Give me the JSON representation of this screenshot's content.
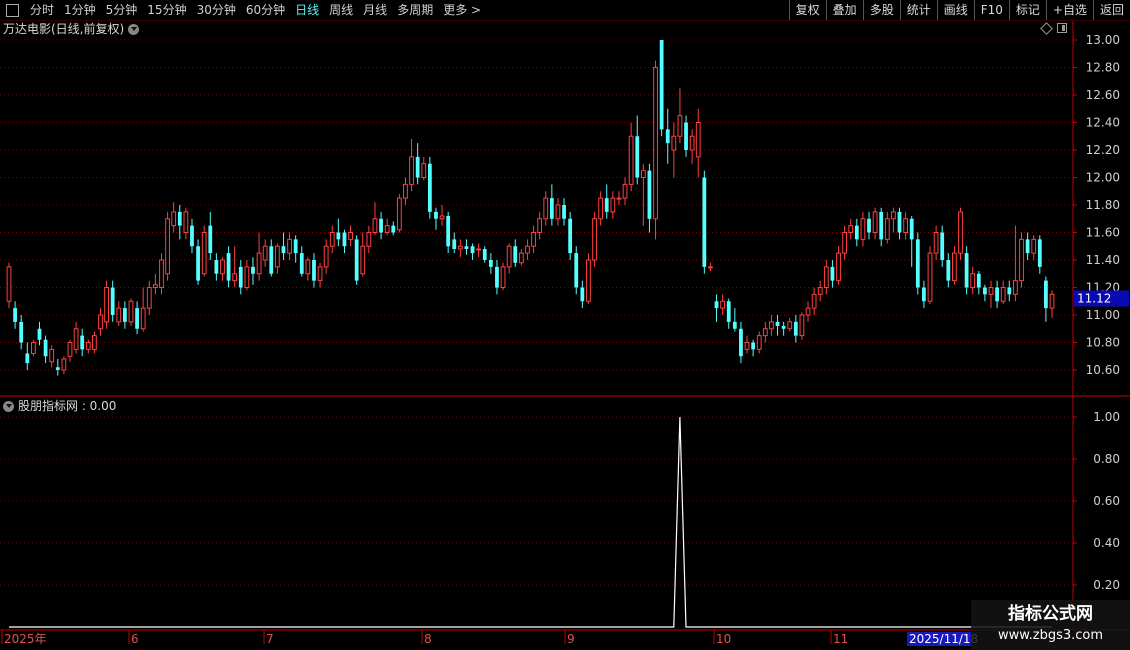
{
  "toolbar": {
    "periods": [
      "分时",
      "1分钟",
      "5分钟",
      "15分钟",
      "30分钟",
      "60分钟",
      "日线",
      "周线",
      "月线",
      "多周期",
      "更多 >"
    ],
    "active_period": "日线",
    "actions": [
      "复权",
      "叠加",
      "多股",
      "统计",
      "画线",
      "F10",
      "标记",
      "+自选",
      "返回"
    ]
  },
  "main_panel": {
    "title": "万达电影(日线,前复权)",
    "price_axis": [
      "13.00",
      "12.80",
      "12.60",
      "12.40",
      "12.20",
      "12.00",
      "11.80",
      "11.60",
      "11.40",
      "11.20",
      "11.00",
      "10.80",
      "10.60"
    ],
    "current_price_label": "11.12"
  },
  "indicator_panel": {
    "title": "股朋指标网 : 0.00",
    "axis": [
      "1.00",
      "0.80",
      "0.60",
      "0.40",
      "0.20"
    ]
  },
  "date_axis": {
    "labels": [
      "2025年",
      "6",
      "7",
      "8",
      "9",
      "10",
      "11"
    ],
    "highlight": "2025/11/18"
  },
  "watermark": {
    "line1": "指标公式网",
    "line2": "www.zbgs3.com"
  },
  "colors": {
    "up": "#ff4040",
    "down": "#54ffff",
    "grid": "#7a0000",
    "axis": "#c00000",
    "indicator_line": "#ffffff"
  },
  "chart_data": {
    "type": "candlestick",
    "ylim": [
      10.5,
      13.0
    ],
    "indicator_ylim": [
      0,
      1.0
    ],
    "candles": [
      [
        11.1,
        11.35,
        11.38,
        11.05
      ],
      [
        11.05,
        10.95,
        11.1,
        10.9
      ],
      [
        10.95,
        10.8,
        11.0,
        10.75
      ],
      [
        10.72,
        10.65,
        10.8,
        10.6
      ],
      [
        10.72,
        10.8,
        10.82,
        10.7
      ],
      [
        10.9,
        10.82,
        10.95,
        10.78
      ],
      [
        10.82,
        10.7,
        10.85,
        10.65
      ],
      [
        10.66,
        10.75,
        10.78,
        10.62
      ],
      [
        10.62,
        10.6,
        10.68,
        10.56
      ],
      [
        10.6,
        10.68,
        10.7,
        10.57
      ],
      [
        10.7,
        10.8,
        10.82,
        10.66
      ],
      [
        10.75,
        10.9,
        10.95,
        10.72
      ],
      [
        10.85,
        10.75,
        10.9,
        10.7
      ],
      [
        10.75,
        10.8,
        10.82,
        10.72
      ],
      [
        10.75,
        10.85,
        10.88,
        10.72
      ],
      [
        10.9,
        11.0,
        11.05,
        10.85
      ],
      [
        10.95,
        11.2,
        11.25,
        10.9
      ],
      [
        11.2,
        11.0,
        11.25,
        10.95
      ],
      [
        10.95,
        11.05,
        11.1,
        10.92
      ],
      [
        11.05,
        10.95,
        11.1,
        10.9
      ],
      [
        10.95,
        11.1,
        11.12,
        10.92
      ],
      [
        11.05,
        10.9,
        11.1,
        10.86
      ],
      [
        10.9,
        11.05,
        11.2,
        10.88
      ],
      [
        11.05,
        11.2,
        11.25,
        11.0
      ],
      [
        11.2,
        11.22,
        11.3,
        11.15
      ],
      [
        11.2,
        11.4,
        11.45,
        11.15
      ],
      [
        11.3,
        11.7,
        11.75,
        11.25
      ],
      [
        11.65,
        11.75,
        11.82,
        11.6
      ],
      [
        11.75,
        11.65,
        11.8,
        11.55
      ],
      [
        11.6,
        11.75,
        11.78,
        11.55
      ],
      [
        11.65,
        11.5,
        11.7,
        11.45
      ],
      [
        11.5,
        11.25,
        11.55,
        11.22
      ],
      [
        11.3,
        11.6,
        11.65,
        11.28
      ],
      [
        11.65,
        11.45,
        11.75,
        11.4
      ],
      [
        11.4,
        11.3,
        11.45,
        11.25
      ],
      [
        11.3,
        11.4,
        11.42,
        11.25
      ],
      [
        11.45,
        11.25,
        11.5,
        11.2
      ],
      [
        11.25,
        11.3,
        11.5,
        11.2
      ],
      [
        11.35,
        11.2,
        11.4,
        11.15
      ],
      [
        11.2,
        11.35,
        11.4,
        11.18
      ],
      [
        11.35,
        11.3,
        11.42,
        11.22
      ],
      [
        11.3,
        11.45,
        11.6,
        11.25
      ],
      [
        11.4,
        11.5,
        11.55,
        11.35
      ],
      [
        11.5,
        11.3,
        11.55,
        11.28
      ],
      [
        11.35,
        11.5,
        11.52,
        11.3
      ],
      [
        11.5,
        11.45,
        11.6,
        11.4
      ],
      [
        11.45,
        11.55,
        11.6,
        11.4
      ],
      [
        11.55,
        11.45,
        11.58,
        11.38
      ],
      [
        11.45,
        11.3,
        11.5,
        11.28
      ],
      [
        11.3,
        11.4,
        11.42,
        11.25
      ],
      [
        11.4,
        11.25,
        11.45,
        11.2
      ],
      [
        11.25,
        11.35,
        11.38,
        11.2
      ],
      [
        11.35,
        11.5,
        11.55,
        11.3
      ],
      [
        11.5,
        11.6,
        11.65,
        11.45
      ],
      [
        11.6,
        11.55,
        11.7,
        11.5
      ],
      [
        11.6,
        11.5,
        11.62,
        11.45
      ],
      [
        11.55,
        11.6,
        11.65,
        11.5
      ],
      [
        11.55,
        11.25,
        11.58,
        11.22
      ],
      [
        11.3,
        11.5,
        11.6,
        11.28
      ],
      [
        11.5,
        11.6,
        11.65,
        11.45
      ],
      [
        11.6,
        11.7,
        11.82,
        11.58
      ],
      [
        11.7,
        11.6,
        11.75,
        11.55
      ],
      [
        11.6,
        11.65,
        11.7,
        11.58
      ],
      [
        11.65,
        11.6,
        11.68,
        11.58
      ],
      [
        11.62,
        11.85,
        11.88,
        11.6
      ],
      [
        11.85,
        11.95,
        12.0,
        11.8
      ],
      [
        11.95,
        12.15,
        12.28,
        11.9
      ],
      [
        12.15,
        12.0,
        12.25,
        11.95
      ],
      [
        12.0,
        12.1,
        12.15,
        11.98
      ],
      [
        12.1,
        11.75,
        12.15,
        11.7
      ],
      [
        11.75,
        11.7,
        11.78,
        11.62
      ],
      [
        11.7,
        11.72,
        11.8,
        11.65
      ],
      [
        11.72,
        11.5,
        11.75,
        11.45
      ],
      [
        11.55,
        11.48,
        11.6,
        11.45
      ],
      [
        11.48,
        11.5,
        11.55,
        11.42
      ],
      [
        11.5,
        11.48,
        11.55,
        11.44
      ],
      [
        11.5,
        11.45,
        11.52,
        11.4
      ],
      [
        11.48,
        11.48,
        11.52,
        11.42
      ],
      [
        11.48,
        11.4,
        11.5,
        11.38
      ],
      [
        11.4,
        11.35,
        11.45,
        11.3
      ],
      [
        11.35,
        11.2,
        11.4,
        11.15
      ],
      [
        11.2,
        11.35,
        11.38,
        11.18
      ],
      [
        11.35,
        11.5,
        11.52,
        11.3
      ],
      [
        11.5,
        11.38,
        11.55,
        11.35
      ],
      [
        11.38,
        11.45,
        11.48,
        11.36
      ],
      [
        11.45,
        11.5,
        11.55,
        11.4
      ],
      [
        11.5,
        11.6,
        11.65,
        11.45
      ],
      [
        11.6,
        11.7,
        11.75,
        11.55
      ],
      [
        11.7,
        11.85,
        11.9,
        11.65
      ],
      [
        11.85,
        11.7,
        11.95,
        11.65
      ],
      [
        11.7,
        11.8,
        11.85,
        11.65
      ],
      [
        11.8,
        11.7,
        11.85,
        11.65
      ],
      [
        11.7,
        11.45,
        11.75,
        11.4
      ],
      [
        11.45,
        11.2,
        11.5,
        11.15
      ],
      [
        11.2,
        11.1,
        11.25,
        11.05
      ],
      [
        11.1,
        11.4,
        11.45,
        11.08
      ],
      [
        11.4,
        11.7,
        11.75,
        11.35
      ],
      [
        11.7,
        11.85,
        11.9,
        11.65
      ],
      [
        11.85,
        11.75,
        11.95,
        11.7
      ],
      [
        11.75,
        11.85,
        11.9,
        11.7
      ],
      [
        11.85,
        11.85,
        11.9,
        11.8
      ],
      [
        11.85,
        11.95,
        12.0,
        11.8
      ],
      [
        11.95,
        12.3,
        12.4,
        11.9
      ],
      [
        12.3,
        12.0,
        12.45,
        11.95
      ],
      [
        12.0,
        12.05,
        12.1,
        11.65
      ],
      [
        12.05,
        11.7,
        12.1,
        11.6
      ],
      [
        11.7,
        12.8,
        12.85,
        11.55
      ],
      [
        13.0,
        12.35,
        13.0,
        12.3
      ],
      [
        12.35,
        12.25,
        12.5,
        12.1
      ],
      [
        12.2,
        12.3,
        12.4,
        12.0
      ],
      [
        12.3,
        12.45,
        12.65,
        12.25
      ],
      [
        12.4,
        12.2,
        12.45,
        12.15
      ],
      [
        12.2,
        12.3,
        12.35,
        12.1
      ],
      [
        12.15,
        12.4,
        12.5,
        12.0
      ],
      [
        12.0,
        11.35,
        12.05,
        11.3
      ],
      [
        11.35,
        11.35,
        11.38,
        11.32
      ],
      [
        11.1,
        11.05,
        11.15,
        10.95
      ],
      [
        11.05,
        11.1,
        11.15,
        11.0
      ],
      [
        11.1,
        10.95,
        11.12,
        10.9
      ],
      [
        10.95,
        10.9,
        11.05,
        10.88
      ],
      [
        10.9,
        10.7,
        10.95,
        10.65
      ],
      [
        10.75,
        10.8,
        10.85,
        10.72
      ],
      [
        10.8,
        10.75,
        10.82,
        10.7
      ],
      [
        10.75,
        10.85,
        10.88,
        10.72
      ],
      [
        10.85,
        10.9,
        10.95,
        10.8
      ],
      [
        10.9,
        10.95,
        11.0,
        10.85
      ],
      [
        10.95,
        10.92,
        11.0,
        10.85
      ],
      [
        10.92,
        10.9,
        10.95,
        10.85
      ],
      [
        10.9,
        10.95,
        10.98,
        10.88
      ],
      [
        10.95,
        10.85,
        11.0,
        10.8
      ],
      [
        10.85,
        11.0,
        11.02,
        10.82
      ],
      [
        11.0,
        11.05,
        11.1,
        10.95
      ],
      [
        11.05,
        11.15,
        11.2,
        11.0
      ],
      [
        11.15,
        11.2,
        11.25,
        11.1
      ],
      [
        11.2,
        11.35,
        11.4,
        11.15
      ],
      [
        11.35,
        11.25,
        11.4,
        11.2
      ],
      [
        11.25,
        11.45,
        11.5,
        11.22
      ],
      [
        11.45,
        11.6,
        11.65,
        11.4
      ],
      [
        11.6,
        11.65,
        11.7,
        11.55
      ],
      [
        11.65,
        11.55,
        11.7,
        11.5
      ],
      [
        11.55,
        11.7,
        11.75,
        11.5
      ],
      [
        11.7,
        11.6,
        11.75,
        11.55
      ],
      [
        11.6,
        11.75,
        11.78,
        11.55
      ],
      [
        11.75,
        11.55,
        11.78,
        11.5
      ],
      [
        11.55,
        11.7,
        11.75,
        11.52
      ],
      [
        11.7,
        11.75,
        11.78,
        11.6
      ],
      [
        11.75,
        11.6,
        11.78,
        11.55
      ],
      [
        11.6,
        11.7,
        11.75,
        11.55
      ],
      [
        11.7,
        11.55,
        11.72,
        11.35
      ],
      [
        11.55,
        11.2,
        11.6,
        11.15
      ],
      [
        11.2,
        11.1,
        11.25,
        11.05
      ],
      [
        11.1,
        11.45,
        11.5,
        11.08
      ],
      [
        11.45,
        11.6,
        11.65,
        11.4
      ],
      [
        11.6,
        11.4,
        11.65,
        11.35
      ],
      [
        11.4,
        11.25,
        11.45,
        11.2
      ],
      [
        11.25,
        11.45,
        11.5,
        11.22
      ],
      [
        11.45,
        11.75,
        11.78,
        11.4
      ],
      [
        11.45,
        11.2,
        11.5,
        11.15
      ],
      [
        11.2,
        11.3,
        11.35,
        11.15
      ],
      [
        11.3,
        11.2,
        11.32,
        11.15
      ],
      [
        11.2,
        11.15,
        11.22,
        11.1
      ],
      [
        11.15,
        11.2,
        11.25,
        11.05
      ],
      [
        11.2,
        11.1,
        11.25,
        11.05
      ],
      [
        11.1,
        11.2,
        11.25,
        11.08
      ],
      [
        11.2,
        11.15,
        11.25,
        11.1
      ],
      [
        11.15,
        11.25,
        11.65,
        11.1
      ],
      [
        11.25,
        11.55,
        11.6,
        11.2
      ],
      [
        11.55,
        11.45,
        11.6,
        11.4
      ],
      [
        11.45,
        11.55,
        11.58,
        11.4
      ],
      [
        11.55,
        11.35,
        11.58,
        11.3
      ],
      [
        11.25,
        11.05,
        11.28,
        10.95
      ],
      [
        11.05,
        11.15,
        11.18,
        10.98
      ]
    ],
    "indicator": {
      "spike_index": 110,
      "value": 1.0
    }
  }
}
